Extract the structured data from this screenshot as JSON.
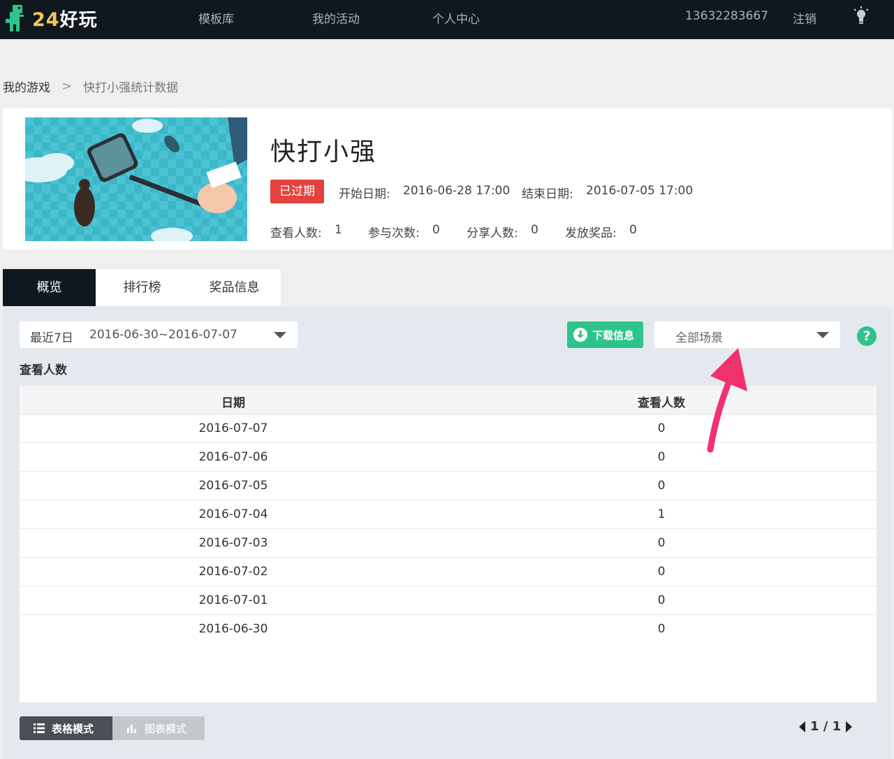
{
  "nav": {
    "logo_num": "24",
    "logo_cn": "好玩",
    "items": [
      "模板库",
      "我的活动",
      "个人中心"
    ],
    "phone": "13632283667",
    "logout": "注销",
    "bulb_icon": "lightbulb-icon"
  },
  "breadcrumb": {
    "home": "我的游戏",
    "separator": ">",
    "current": "快打小强统计数据"
  },
  "game": {
    "title": "快打小强",
    "status": "已过期",
    "start_label": "开始日期:",
    "start_value": "2016-06-28 17:00",
    "end_label": "结束日期:",
    "end_value": "2016-07-05 17:00",
    "stats": [
      {
        "label": "查看人数:",
        "value": "1"
      },
      {
        "label": "参与次数:",
        "value": "0"
      },
      {
        "label": "分享人数:",
        "value": "0"
      },
      {
        "label": "发放奖品:",
        "value": "0"
      }
    ]
  },
  "tabs": [
    "概览",
    "排行榜",
    "奖品信息"
  ],
  "filters": {
    "range_label": "最近7日",
    "range_value": "2016-06-30~2016-07-07",
    "download": "下载信息",
    "scene": "全部场景",
    "help": "?"
  },
  "section_label": "查看人数",
  "table": {
    "headers": [
      "日期",
      "查看人数"
    ],
    "rows": [
      [
        "2016-07-07",
        "0"
      ],
      [
        "2016-07-06",
        "0"
      ],
      [
        "2016-07-05",
        "0"
      ],
      [
        "2016-07-04",
        "1"
      ],
      [
        "2016-07-03",
        "0"
      ],
      [
        "2016-07-02",
        "0"
      ],
      [
        "2016-07-01",
        "0"
      ],
      [
        "2016-06-30",
        "0"
      ]
    ]
  },
  "modes": {
    "table": "表格模式",
    "chart": "图表模式"
  },
  "pager": {
    "text": "1 / 1"
  },
  "colors": {
    "nav_bg": "#10181f",
    "accent_green": "#2dc38a",
    "expired_red": "#e3423e",
    "annotation_pink": "#f0316e"
  }
}
